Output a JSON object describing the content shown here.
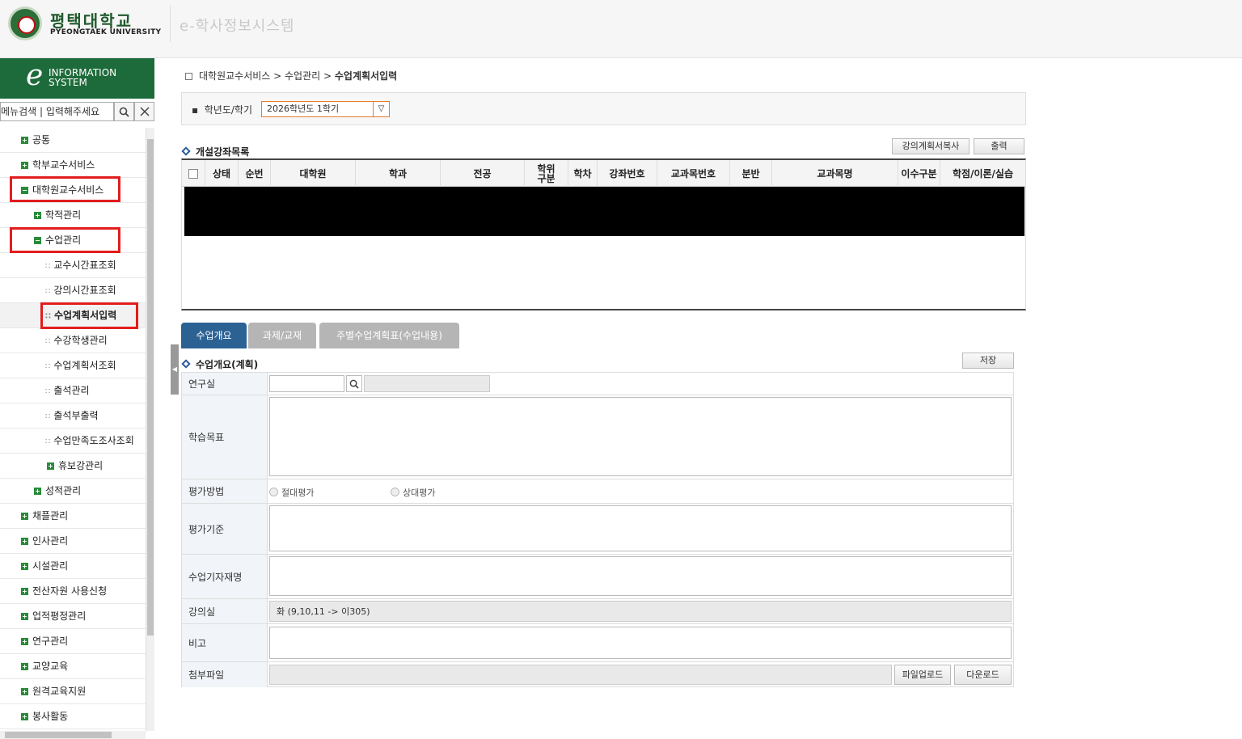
{
  "header": {
    "logo_ko": "평택대학교",
    "logo_en": "PYEONGTAEK UNIVERSITY",
    "system_title": "e-학사정보시스템"
  },
  "brand": {
    "letter": "e",
    "line1": "INFORMATION",
    "line2": "SYSTEM"
  },
  "menu_search": {
    "placeholder": "메뉴검색 | 입력해주세요"
  },
  "sidebar": {
    "items": [
      {
        "label": "공통"
      },
      {
        "label": "학부교수서비스"
      },
      {
        "label": "대학원교수서비스"
      },
      {
        "label": "학적관리"
      },
      {
        "label": "수업관리"
      },
      {
        "label": "교수시간표조회"
      },
      {
        "label": "강의시간표조회"
      },
      {
        "label": "수업계획서입력"
      },
      {
        "label": "수강학생관리"
      },
      {
        "label": "수업계획서조회"
      },
      {
        "label": "출석관리"
      },
      {
        "label": "출석부출력"
      },
      {
        "label": "수업만족도조사조회"
      },
      {
        "label": "휴보강관리"
      },
      {
        "label": "성적관리"
      },
      {
        "label": "채플관리"
      },
      {
        "label": "인사관리"
      },
      {
        "label": "시설관리"
      },
      {
        "label": "전산자원 사용신청"
      },
      {
        "label": "업적평정관리"
      },
      {
        "label": "연구관리"
      },
      {
        "label": "교양교육"
      },
      {
        "label": "원격교육지원"
      },
      {
        "label": "봉사활동"
      }
    ]
  },
  "breadcrumb": {
    "level1": "대학원교수서비스",
    "level2": "수업관리",
    "current": "수업계획서입력"
  },
  "filter": {
    "label": "학년도/학기",
    "semester_value": "2026학년도 1학기"
  },
  "course_list": {
    "title": "개설강좌목록",
    "copy_button": "강의계획서복사",
    "print_button": "출력",
    "columns": [
      "상태",
      "순번",
      "대학원",
      "학과",
      "전공",
      "학위구분",
      "학차",
      "강좌번호",
      "교과목번호",
      "분반",
      "교과목명",
      "이수구분",
      "학점/이론/실습"
    ]
  },
  "tabs": [
    {
      "label": "수업개요"
    },
    {
      "label": "과제/교재"
    },
    {
      "label": "주별수업계획표(수업내용)"
    }
  ],
  "overview": {
    "title": "수업개요(계획)",
    "save_button": "저장",
    "labels": {
      "lab": "연구실",
      "goal": "학습목표",
      "eval_method": "평가방법",
      "eval_criteria": "평가기준",
      "materials": "수업기자재명",
      "room": "강의실",
      "note": "비고",
      "attachment": "첨부파일"
    },
    "eval_options": [
      "절대평가",
      "상대평가"
    ],
    "room_value": "화 (9,10,11 -> 이305)",
    "upload_button": "파일업로드",
    "download_button": "다운로드"
  },
  "colors": {
    "brand_green": "#1d6b3a",
    "tab_active": "#2c6293",
    "highlight_red": "#e21d1d"
  }
}
